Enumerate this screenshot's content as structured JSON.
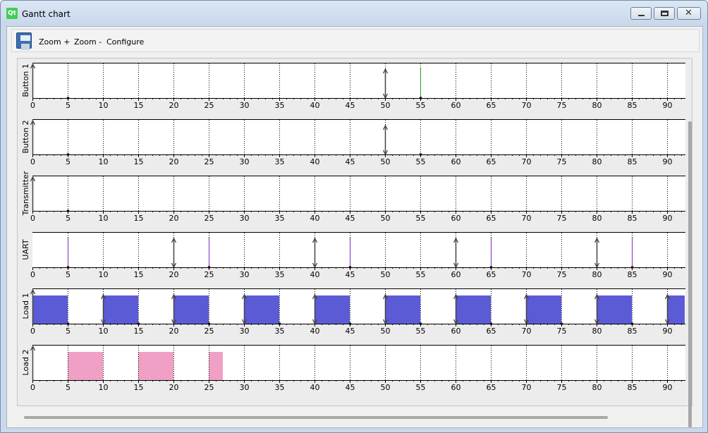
{
  "window": {
    "title": "Gantt chart",
    "logo_text": "Qt"
  },
  "toolbar": {
    "zoom_in_label": "Zoom +",
    "zoom_out_label": "Zoom -",
    "configure_label": "Configure"
  },
  "chart_data": {
    "type": "gantt",
    "x_ticks": [
      0,
      5,
      10,
      15,
      20,
      25,
      30,
      35,
      40,
      45,
      50,
      55,
      60,
      65,
      70,
      75,
      80,
      85,
      90
    ],
    "xlim": [
      0,
      92.5
    ],
    "rows": [
      {
        "name": "Button 1",
        "arrows": [
          0,
          50
        ],
        "markers": [
          {
            "x": 55,
            "color": "#2aa02a"
          }
        ],
        "dots": [
          5,
          55
        ],
        "bars": []
      },
      {
        "name": "Button 2",
        "arrows": [
          0,
          50
        ],
        "markers": [],
        "dots": [
          5,
          55
        ],
        "bars": []
      },
      {
        "name": "Transmitter",
        "arrows": [
          0
        ],
        "markers": [],
        "dots": [
          5
        ],
        "bars": []
      },
      {
        "name": "UART",
        "arrows": [
          20,
          40,
          60,
          80
        ],
        "markers": [
          {
            "x": 5,
            "color": "#7b2fbf"
          },
          {
            "x": 25,
            "color": "#7b2fbf"
          },
          {
            "x": 45,
            "color": "#7b2fbf"
          },
          {
            "x": 65,
            "color": "#7b2fbf"
          },
          {
            "x": 85,
            "color": "#7b2fbf"
          }
        ],
        "dots": [
          5,
          25,
          45,
          65,
          85
        ],
        "bars": []
      },
      {
        "name": "Load 1",
        "arrows": [
          0,
          10,
          20,
          30,
          40,
          50,
          60,
          70,
          80,
          90
        ],
        "markers": [],
        "dots": [
          5,
          15,
          25,
          35,
          45,
          55,
          65,
          75,
          85
        ],
        "bars": [
          {
            "start": 0,
            "end": 5
          },
          {
            "start": 10,
            "end": 15
          },
          {
            "start": 20,
            "end": 25
          },
          {
            "start": 30,
            "end": 35
          },
          {
            "start": 40,
            "end": 45
          },
          {
            "start": 50,
            "end": 55
          },
          {
            "start": 60,
            "end": 65
          },
          {
            "start": 70,
            "end": 75
          },
          {
            "start": 80,
            "end": 85
          },
          {
            "start": 90,
            "end": 92.5
          }
        ],
        "bar_color": "#5b5bd6"
      },
      {
        "name": "Load 2",
        "arrows": [
          0
        ],
        "markers": [],
        "dots": [],
        "bars": [
          {
            "start": 5,
            "end": 10
          },
          {
            "start": 15,
            "end": 20
          },
          {
            "start": 25,
            "end": 27
          }
        ],
        "bar_color": "#f0a0c4"
      }
    ]
  }
}
